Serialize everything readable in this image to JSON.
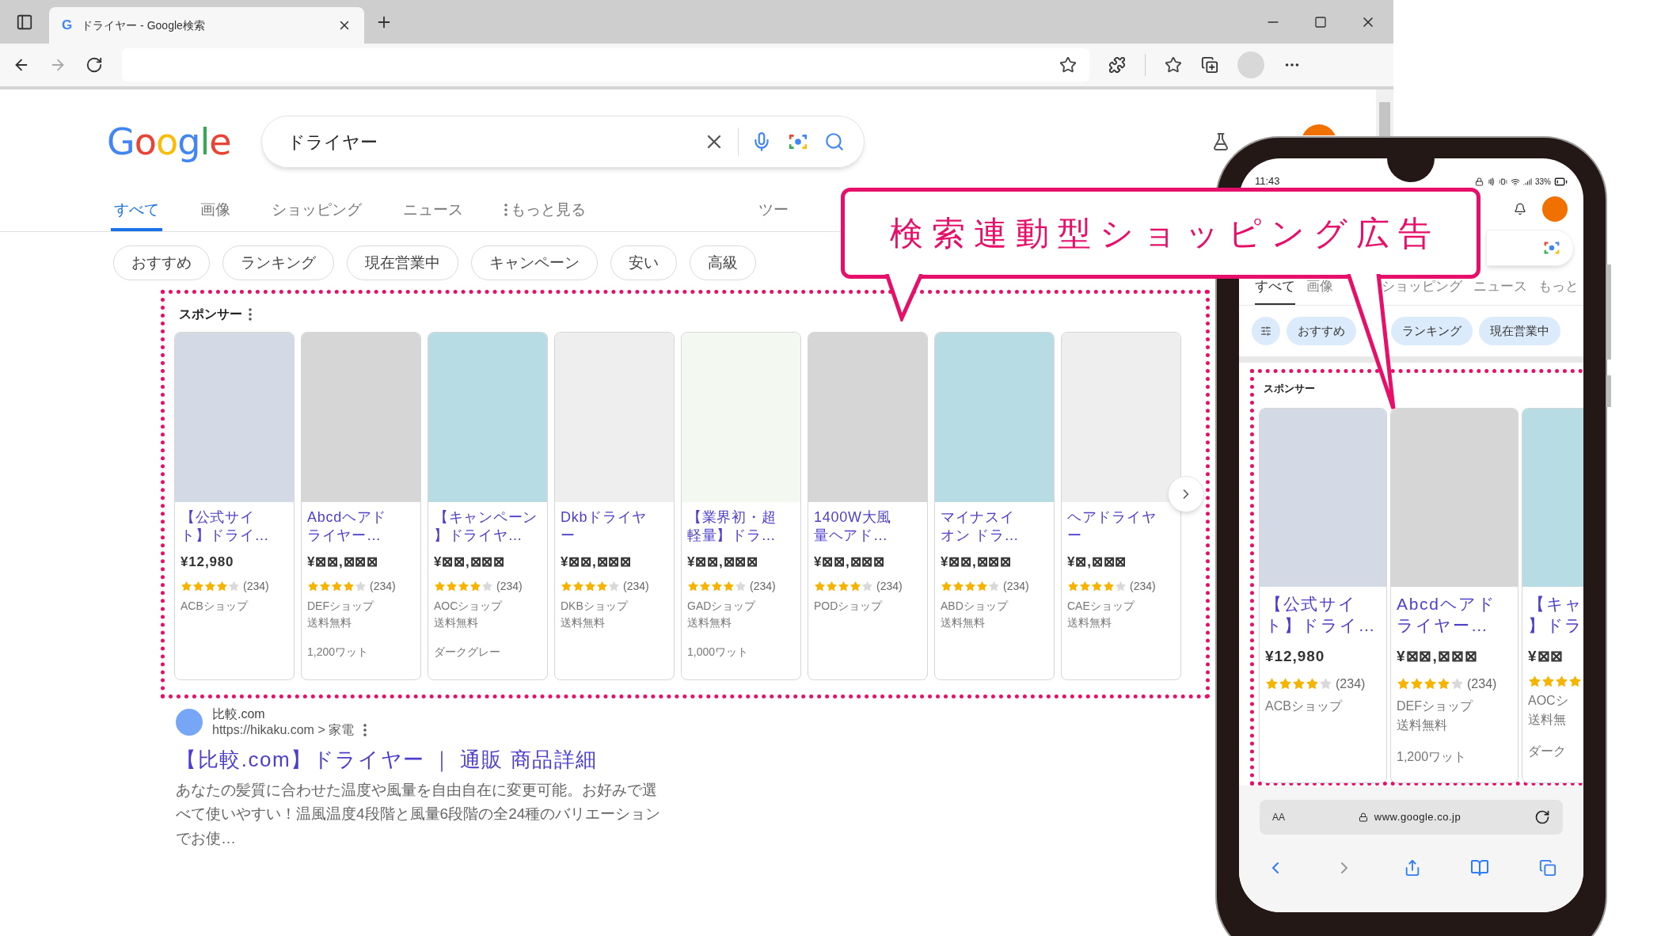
{
  "browser": {
    "tab_icon": "G",
    "tab_title": "ドライヤー - Google検索"
  },
  "logo": "Google",
  "search": {
    "query": "ドライヤー"
  },
  "tabs": [
    {
      "label": "すべて",
      "selected": true,
      "kind": "tab"
    },
    {
      "label": "画像",
      "selected": false,
      "kind": "tab"
    },
    {
      "label": "ショッピング",
      "selected": false,
      "kind": "tab"
    },
    {
      "label": "ニュース",
      "selected": false,
      "kind": "tab"
    },
    {
      "label": "もっと見る",
      "selected": false,
      "kind": "more"
    },
    {
      "label": "ツー",
      "selected": false,
      "kind": "tab"
    }
  ],
  "chips": [
    "おすすめ",
    "ランキング",
    "現在営業中",
    "キャンペーン",
    "安い",
    "高級"
  ],
  "sponsored": {
    "label": "スポンサー",
    "cards": [
      {
        "color": "#d3dae6",
        "title_lines": [
          "【公式サイ",
          "ト】ドライ…"
        ],
        "price": "¥12,980",
        "stars": 4,
        "reviews": "(234)",
        "shop": "ACBショップ"
      },
      {
        "color": "#d6d6d6",
        "title_lines": [
          "Abcdヘアド",
          "ライヤー…"
        ],
        "price": "¥⊠⊠,⊠⊠⊠",
        "stars": 4,
        "reviews": "(234)",
        "shop": "DEFショップ",
        "shipping": "送料無料",
        "extra": "1,200ワット"
      },
      {
        "color": "#b8dce4",
        "title_lines": [
          "【キャンペーン",
          "】ドライヤ…"
        ],
        "price": "¥⊠⊠,⊠⊠⊠",
        "stars": 4,
        "reviews": "(234)",
        "shop": "AOCショップ",
        "shipping": "送料無料",
        "extra": "ダークグレー"
      },
      {
        "color": "#eeeeee",
        "title_lines": [
          "Dkbドライヤ",
          "ー"
        ],
        "price": "¥⊠⊠,⊠⊠⊠",
        "stars": 4,
        "reviews": "(234)",
        "shop": "DKBショップ",
        "shipping": "送料無料"
      },
      {
        "color": "#f3f8f1",
        "title_lines": [
          "【業界初・超",
          "軽量】ドラ…"
        ],
        "price": "¥⊠⊠,⊠⊠⊠",
        "stars": 4,
        "reviews": "(234)",
        "shop": "GADショップ",
        "shipping": "送料無料",
        "extra": "1,000ワット"
      },
      {
        "color": "#d6d6d6",
        "title_lines": [
          "1400W大風",
          "量ヘアド…"
        ],
        "price": "¥⊠⊠,⊠⊠⊠",
        "stars": 4,
        "reviews": "(234)",
        "shop": "PODショップ"
      },
      {
        "color": "#b8dce4",
        "title_lines": [
          "マイナスイ",
          "オン ドラ…"
        ],
        "price": "¥⊠⊠,⊠⊠⊠",
        "stars": 4,
        "reviews": "(234)",
        "shop": "ABDショップ",
        "shipping": "送料無料"
      },
      {
        "color": "#eeeeee",
        "title_lines": [
          "ヘアドライヤ",
          "ー"
        ],
        "price": "¥⊠,⊠⊠⊠",
        "stars": 4,
        "reviews": "(234)",
        "shop": "CAEショップ",
        "shipping": "送料無料"
      }
    ]
  },
  "result": {
    "site": "比較.com",
    "url": "https://hikaku.com > 家電",
    "title": "【比較.com】ドライヤー ｜ 通販 商品詳細",
    "snippet": "あなたの髪質に合わせた温度や風量を自由自在に変更可能。お好みで選べて使いやすい！温風温度4段階と風量6段階の全24種のバリエーションでお使…"
  },
  "callout": {
    "text": "検索連動型ショッピング広告"
  },
  "phone": {
    "time": "11:43",
    "battery": "33%",
    "tabs": [
      {
        "label": "すべて",
        "selected": true
      },
      {
        "label": "画像",
        "selected": false
      },
      {
        "label": "ショッピング",
        "selected": false
      },
      {
        "label": "ニュース",
        "selected": false
      },
      {
        "label": "もっと",
        "selected": false
      }
    ],
    "chips": [
      "おすすめ",
      "ランキング",
      "現在営業中"
    ],
    "sponsor_label": "スポンサー",
    "cards": [
      {
        "color": "#d3dae6",
        "title_lines": [
          "【公式サイ",
          "ト】ドライ…"
        ],
        "price": "¥12,980",
        "stars": 4,
        "reviews": "(234)",
        "shop": "ACBショップ"
      },
      {
        "color": "#d6d6d6",
        "title_lines": [
          "Abcdヘアド",
          "ライヤー…"
        ],
        "price": "¥⊠⊠,⊠⊠⊠",
        "stars": 4,
        "reviews": "(234)",
        "shop": "DEFショップ",
        "shipping": "送料無料",
        "extra": "1,200ワット"
      },
      {
        "color": "#b8dce4",
        "title_lines": [
          "【キャ",
          "】ドラ"
        ],
        "price": "¥⊠⊠",
        "stars": 4,
        "shop": "AOCシ",
        "shipping": "送料無",
        "extra": "ダーク"
      }
    ],
    "text_size": "AA",
    "address": "www.google.co.jp"
  }
}
